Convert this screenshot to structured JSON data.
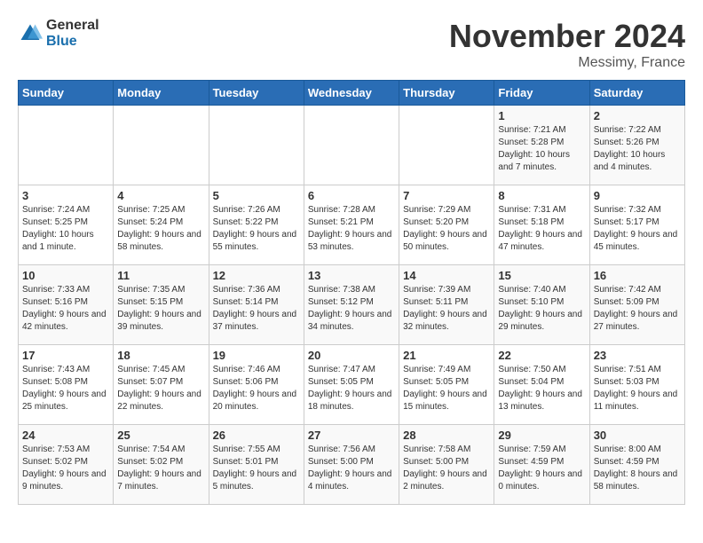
{
  "logo": {
    "general": "General",
    "blue": "Blue"
  },
  "title": {
    "month": "November 2024",
    "location": "Messimy, France"
  },
  "weekdays": [
    "Sunday",
    "Monday",
    "Tuesday",
    "Wednesday",
    "Thursday",
    "Friday",
    "Saturday"
  ],
  "weeks": [
    [
      {
        "date": "",
        "info": ""
      },
      {
        "date": "",
        "info": ""
      },
      {
        "date": "",
        "info": ""
      },
      {
        "date": "",
        "info": ""
      },
      {
        "date": "",
        "info": ""
      },
      {
        "date": "1",
        "info": "Sunrise: 7:21 AM\nSunset: 5:28 PM\nDaylight: 10 hours and 7 minutes."
      },
      {
        "date": "2",
        "info": "Sunrise: 7:22 AM\nSunset: 5:26 PM\nDaylight: 10 hours and 4 minutes."
      }
    ],
    [
      {
        "date": "3",
        "info": "Sunrise: 7:24 AM\nSunset: 5:25 PM\nDaylight: 10 hours and 1 minute."
      },
      {
        "date": "4",
        "info": "Sunrise: 7:25 AM\nSunset: 5:24 PM\nDaylight: 9 hours and 58 minutes."
      },
      {
        "date": "5",
        "info": "Sunrise: 7:26 AM\nSunset: 5:22 PM\nDaylight: 9 hours and 55 minutes."
      },
      {
        "date": "6",
        "info": "Sunrise: 7:28 AM\nSunset: 5:21 PM\nDaylight: 9 hours and 53 minutes."
      },
      {
        "date": "7",
        "info": "Sunrise: 7:29 AM\nSunset: 5:20 PM\nDaylight: 9 hours and 50 minutes."
      },
      {
        "date": "8",
        "info": "Sunrise: 7:31 AM\nSunset: 5:18 PM\nDaylight: 9 hours and 47 minutes."
      },
      {
        "date": "9",
        "info": "Sunrise: 7:32 AM\nSunset: 5:17 PM\nDaylight: 9 hours and 45 minutes."
      }
    ],
    [
      {
        "date": "10",
        "info": "Sunrise: 7:33 AM\nSunset: 5:16 PM\nDaylight: 9 hours and 42 minutes."
      },
      {
        "date": "11",
        "info": "Sunrise: 7:35 AM\nSunset: 5:15 PM\nDaylight: 9 hours and 39 minutes."
      },
      {
        "date": "12",
        "info": "Sunrise: 7:36 AM\nSunset: 5:14 PM\nDaylight: 9 hours and 37 minutes."
      },
      {
        "date": "13",
        "info": "Sunrise: 7:38 AM\nSunset: 5:12 PM\nDaylight: 9 hours and 34 minutes."
      },
      {
        "date": "14",
        "info": "Sunrise: 7:39 AM\nSunset: 5:11 PM\nDaylight: 9 hours and 32 minutes."
      },
      {
        "date": "15",
        "info": "Sunrise: 7:40 AM\nSunset: 5:10 PM\nDaylight: 9 hours and 29 minutes."
      },
      {
        "date": "16",
        "info": "Sunrise: 7:42 AM\nSunset: 5:09 PM\nDaylight: 9 hours and 27 minutes."
      }
    ],
    [
      {
        "date": "17",
        "info": "Sunrise: 7:43 AM\nSunset: 5:08 PM\nDaylight: 9 hours and 25 minutes."
      },
      {
        "date": "18",
        "info": "Sunrise: 7:45 AM\nSunset: 5:07 PM\nDaylight: 9 hours and 22 minutes."
      },
      {
        "date": "19",
        "info": "Sunrise: 7:46 AM\nSunset: 5:06 PM\nDaylight: 9 hours and 20 minutes."
      },
      {
        "date": "20",
        "info": "Sunrise: 7:47 AM\nSunset: 5:05 PM\nDaylight: 9 hours and 18 minutes."
      },
      {
        "date": "21",
        "info": "Sunrise: 7:49 AM\nSunset: 5:05 PM\nDaylight: 9 hours and 15 minutes."
      },
      {
        "date": "22",
        "info": "Sunrise: 7:50 AM\nSunset: 5:04 PM\nDaylight: 9 hours and 13 minutes."
      },
      {
        "date": "23",
        "info": "Sunrise: 7:51 AM\nSunset: 5:03 PM\nDaylight: 9 hours and 11 minutes."
      }
    ],
    [
      {
        "date": "24",
        "info": "Sunrise: 7:53 AM\nSunset: 5:02 PM\nDaylight: 9 hours and 9 minutes."
      },
      {
        "date": "25",
        "info": "Sunrise: 7:54 AM\nSunset: 5:02 PM\nDaylight: 9 hours and 7 minutes."
      },
      {
        "date": "26",
        "info": "Sunrise: 7:55 AM\nSunset: 5:01 PM\nDaylight: 9 hours and 5 minutes."
      },
      {
        "date": "27",
        "info": "Sunrise: 7:56 AM\nSunset: 5:00 PM\nDaylight: 9 hours and 4 minutes."
      },
      {
        "date": "28",
        "info": "Sunrise: 7:58 AM\nSunset: 5:00 PM\nDaylight: 9 hours and 2 minutes."
      },
      {
        "date": "29",
        "info": "Sunrise: 7:59 AM\nSunset: 4:59 PM\nDaylight: 9 hours and 0 minutes."
      },
      {
        "date": "30",
        "info": "Sunrise: 8:00 AM\nSunset: 4:59 PM\nDaylight: 8 hours and 58 minutes."
      }
    ]
  ]
}
